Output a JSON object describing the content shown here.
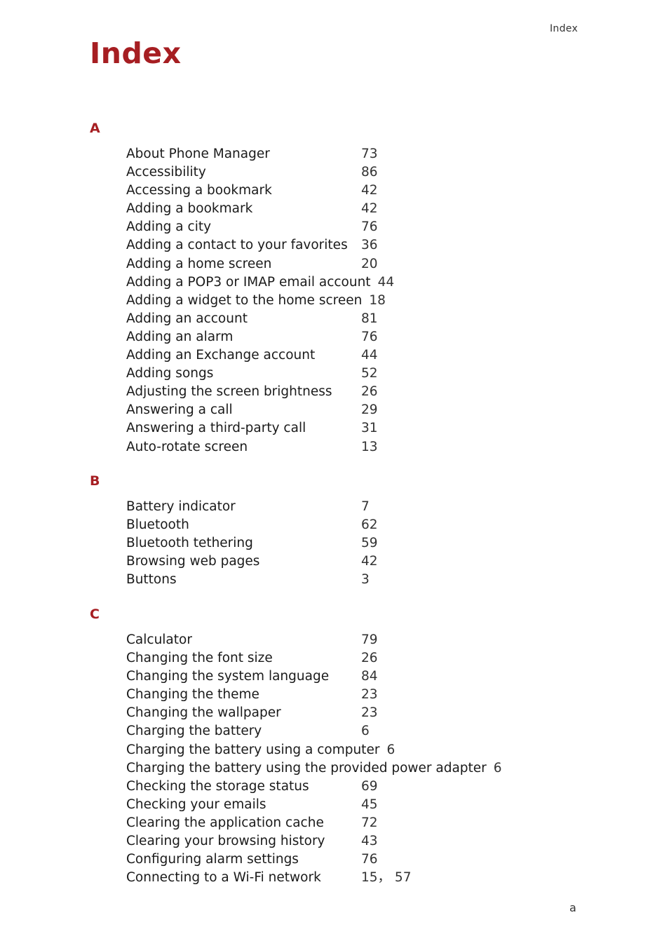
{
  "running_head": "Index",
  "title": "Index",
  "folio": "a",
  "sections": [
    {
      "letter": "A",
      "entries": [
        {
          "term": "About Phone Manager",
          "pages": "73"
        },
        {
          "term": "Accessibility",
          "pages": "86"
        },
        {
          "term": "Accessing a bookmark",
          "pages": "42"
        },
        {
          "term": "Adding a bookmark",
          "pages": "42"
        },
        {
          "term": "Adding a city",
          "pages": "76"
        },
        {
          "term": "Adding a contact to your favorites",
          "pages": "36"
        },
        {
          "term": "Adding a home screen",
          "pages": "20"
        },
        {
          "term": "Adding a POP3 or IMAP email account",
          "pages": "44"
        },
        {
          "term": "Adding a widget to the home screen",
          "pages": "18"
        },
        {
          "term": "Adding an account",
          "pages": "81"
        },
        {
          "term": "Adding an alarm",
          "pages": "76"
        },
        {
          "term": "Adding an Exchange account",
          "pages": "44"
        },
        {
          "term": "Adding songs",
          "pages": "52"
        },
        {
          "term": "Adjusting the screen brightness",
          "pages": "26"
        },
        {
          "term": "Answering a call",
          "pages": "29"
        },
        {
          "term": "Answering a third-party call",
          "pages": "31"
        },
        {
          "term": "Auto-rotate screen",
          "pages": "13"
        }
      ]
    },
    {
      "letter": "B",
      "entries": [
        {
          "term": "Battery indicator",
          "pages": "7"
        },
        {
          "term": "Bluetooth",
          "pages": "62"
        },
        {
          "term": "Bluetooth tethering",
          "pages": "59"
        },
        {
          "term": "Browsing web pages",
          "pages": "42"
        },
        {
          "term": "Buttons",
          "pages": "3"
        }
      ]
    },
    {
      "letter": "C",
      "entries": [
        {
          "term": "Calculator",
          "pages": "79"
        },
        {
          "term": "Changing the font size",
          "pages": "26"
        },
        {
          "term": "Changing the system language",
          "pages": "84"
        },
        {
          "term": "Changing the theme",
          "pages": "23"
        },
        {
          "term": "Changing the wallpaper",
          "pages": "23"
        },
        {
          "term": "Charging the battery",
          "pages": "6"
        },
        {
          "term": "Charging the battery using a computer",
          "pages": "6"
        },
        {
          "term": "Charging the battery using the provided power adapter",
          "pages": "6"
        },
        {
          "term": "Checking the storage status",
          "pages": "69"
        },
        {
          "term": "Checking your emails",
          "pages": "45"
        },
        {
          "term": "Clearing the application cache",
          "pages": "72"
        },
        {
          "term": "Clearing your browsing history",
          "pages": "43"
        },
        {
          "term": "Configuring alarm settings",
          "pages": "76"
        },
        {
          "term": "Connecting to a Wi-Fi network",
          "pages": "15， 57"
        }
      ]
    }
  ]
}
